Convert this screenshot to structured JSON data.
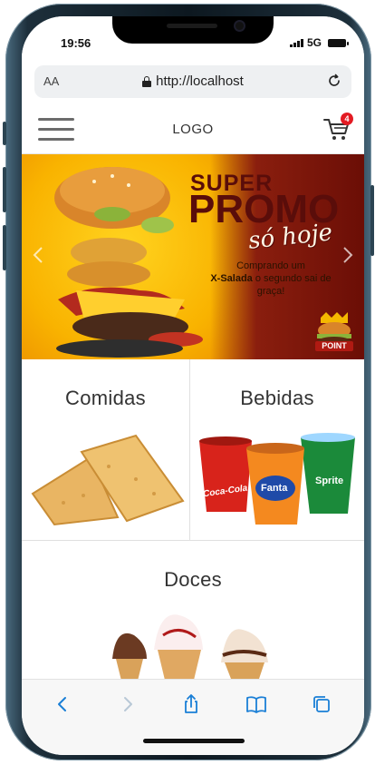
{
  "status_bar": {
    "time": "19:56",
    "network": "5G"
  },
  "browser": {
    "text_size_label": "AA",
    "url": "http://localhost"
  },
  "header": {
    "logo": "LOGO",
    "cart_count": "4"
  },
  "banner": {
    "line1": "SUPER",
    "line2": "PROMO",
    "script": "só hoje",
    "desc_part1": "Comprando um",
    "desc_bold": "X-Salada",
    "desc_part2": "o segundo sai de graça!",
    "brand": "POINT"
  },
  "categories": [
    {
      "label": "Comidas"
    },
    {
      "label": "Bebidas"
    },
    {
      "label": "Doces"
    }
  ],
  "drinks": {
    "cup1": "Coca-Cola",
    "cup2": "Fanta",
    "cup3": "Sprite"
  },
  "colors": {
    "accent_blue": "#1a7fd6",
    "badge_red": "#e31b23",
    "promo_dark": "#5a0d0a"
  }
}
